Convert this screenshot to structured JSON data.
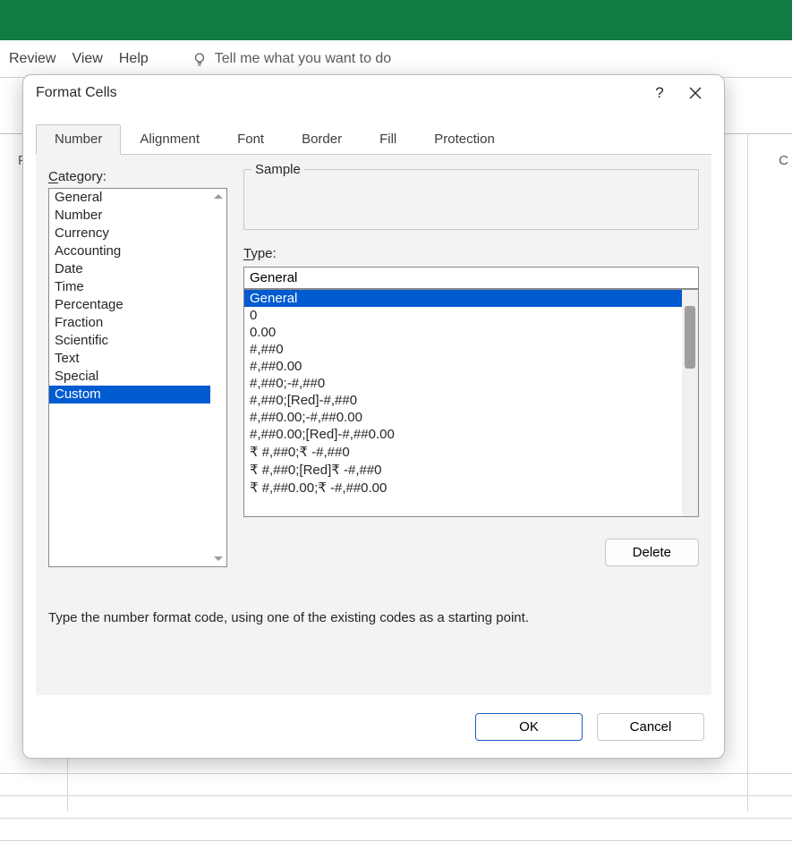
{
  "ribbon": {
    "tabs": [
      "Review",
      "View",
      "Help"
    ],
    "tell_me": "Tell me what you want to do"
  },
  "sheet": {
    "col_left": "F",
    "col_right": "C"
  },
  "dialog": {
    "title": "Format Cells",
    "help_symbol": "?",
    "tabs": [
      {
        "label": "Number",
        "active": true
      },
      {
        "label": "Alignment",
        "active": false
      },
      {
        "label": "Font",
        "active": false
      },
      {
        "label": "Border",
        "active": false
      },
      {
        "label": "Fill",
        "active": false
      },
      {
        "label": "Protection",
        "active": false
      }
    ],
    "category_label_pre": "C",
    "category_label_post": "ategory:",
    "categories": [
      {
        "label": "General",
        "selected": false
      },
      {
        "label": "Number",
        "selected": false
      },
      {
        "label": "Currency",
        "selected": false
      },
      {
        "label": "Accounting",
        "selected": false
      },
      {
        "label": "Date",
        "selected": false
      },
      {
        "label": "Time",
        "selected": false
      },
      {
        "label": "Percentage",
        "selected": false
      },
      {
        "label": "Fraction",
        "selected": false
      },
      {
        "label": "Scientific",
        "selected": false
      },
      {
        "label": "Text",
        "selected": false
      },
      {
        "label": "Special",
        "selected": false
      },
      {
        "label": "Custom",
        "selected": true
      }
    ],
    "sample_label": "Sample",
    "sample_value": "",
    "type_label_pre": "T",
    "type_label_post": "ype:",
    "type_value": "General",
    "type_list": [
      {
        "label": "General",
        "selected": true
      },
      {
        "label": "0",
        "selected": false
      },
      {
        "label": "0.00",
        "selected": false
      },
      {
        "label": "#,##0",
        "selected": false
      },
      {
        "label": "#,##0.00",
        "selected": false
      },
      {
        "label": "#,##0;-#,##0",
        "selected": false
      },
      {
        "label": "#,##0;[Red]-#,##0",
        "selected": false
      },
      {
        "label": "#,##0.00;-#,##0.00",
        "selected": false
      },
      {
        "label": "#,##0.00;[Red]-#,##0.00",
        "selected": false
      },
      {
        "label": "₹ #,##0;₹ -#,##0",
        "selected": false
      },
      {
        "label": "₹ #,##0;[Red]₹ -#,##0",
        "selected": false
      },
      {
        "label": "₹ #,##0.00;₹ -#,##0.00",
        "selected": false
      }
    ],
    "delete_label": "Delete",
    "hint": "Type the number format code, using one of the existing codes as a starting point.",
    "ok_label": "OK",
    "cancel_label": "Cancel"
  }
}
